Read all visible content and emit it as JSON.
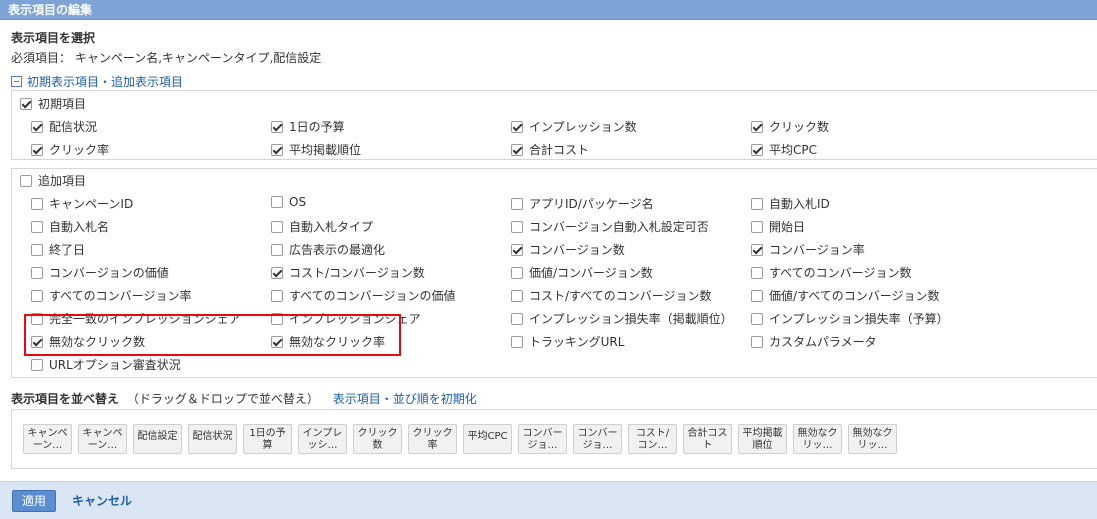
{
  "window": {
    "title": "表示項目の編集"
  },
  "select_section": {
    "heading": "表示項目を選択",
    "required_label": "必須項目：",
    "required_values": "キャンペーン名,キャンペーンタイプ,配信設定",
    "toggle_link": "初期表示項目・追加表示項目"
  },
  "initial_group": {
    "label": "初期項目",
    "checked": true,
    "items": [
      {
        "label": "配信状況",
        "checked": true
      },
      {
        "label": "1日の予算",
        "checked": true
      },
      {
        "label": "インプレッション数",
        "checked": true
      },
      {
        "label": "クリック数",
        "checked": true
      },
      {
        "label": "クリック率",
        "checked": true
      },
      {
        "label": "平均掲載順位",
        "checked": true
      },
      {
        "label": "合計コスト",
        "checked": true
      },
      {
        "label": "平均CPC",
        "checked": true
      }
    ]
  },
  "additional_group": {
    "label": "追加項目",
    "checked": false,
    "items": [
      {
        "label": "キャンペーンID",
        "checked": false
      },
      {
        "label": "OS",
        "checked": false
      },
      {
        "label": "アプリID/パッケージ名",
        "checked": false
      },
      {
        "label": "自動入札ID",
        "checked": false
      },
      {
        "label": "自動入札名",
        "checked": false
      },
      {
        "label": "自動入札タイプ",
        "checked": false
      },
      {
        "label": "コンバージョン自動入札設定可否",
        "checked": false
      },
      {
        "label": "開始日",
        "checked": false
      },
      {
        "label": "終了日",
        "checked": false
      },
      {
        "label": "広告表示の最適化",
        "checked": false
      },
      {
        "label": "コンバージョン数",
        "checked": true
      },
      {
        "label": "コンバージョン率",
        "checked": true
      },
      {
        "label": "コンバージョンの価値",
        "checked": false
      },
      {
        "label": "コスト/コンバージョン数",
        "checked": true
      },
      {
        "label": "価値/コンバージョン数",
        "checked": false
      },
      {
        "label": "すべてのコンバージョン数",
        "checked": false
      },
      {
        "label": "すべてのコンバージョン率",
        "checked": false
      },
      {
        "label": "すべてのコンバージョンの価値",
        "checked": false
      },
      {
        "label": "コスト/すべてのコンバージョン数",
        "checked": false
      },
      {
        "label": "価値/すべてのコンバージョン数",
        "checked": false
      },
      {
        "label": "完全一致のインプレッションシェア",
        "checked": false
      },
      {
        "label": "インプレッションシェア",
        "checked": false
      },
      {
        "label": "インプレッション損失率（掲載順位）",
        "checked": false
      },
      {
        "label": "インプレッション損失率（予算）",
        "checked": false
      },
      {
        "label": "無効なクリック数",
        "checked": true
      },
      {
        "label": "無効なクリック率",
        "checked": true
      },
      {
        "label": "トラッキングURL",
        "checked": false
      },
      {
        "label": "カスタムパラメータ",
        "checked": false
      },
      {
        "label": "URLオプション審査状況",
        "checked": false
      }
    ]
  },
  "sort_section": {
    "heading": "表示項目を並べ替え",
    "hint": "（ドラッグ＆ドロップで並べ替え）",
    "reset_link": "表示項目・並び順を初期化",
    "chips": [
      "キャンペ\nーン…",
      "キャンペ\nーン…",
      "配信設定",
      "配信状況",
      "1日の予\n算",
      "インプレ\nッシ…",
      "クリック\n数",
      "クリック\n率",
      "平均CPC",
      "コンバー\nジョ…",
      "コンバー\nジョ…",
      "コスト/\nコン…",
      "合計コス\nト",
      "平均掲載\n順位",
      "無効なク\nリッ…",
      "無効なク\nリッ…"
    ]
  },
  "footer": {
    "apply_label": "適用",
    "cancel_label": "キャンセル"
  }
}
